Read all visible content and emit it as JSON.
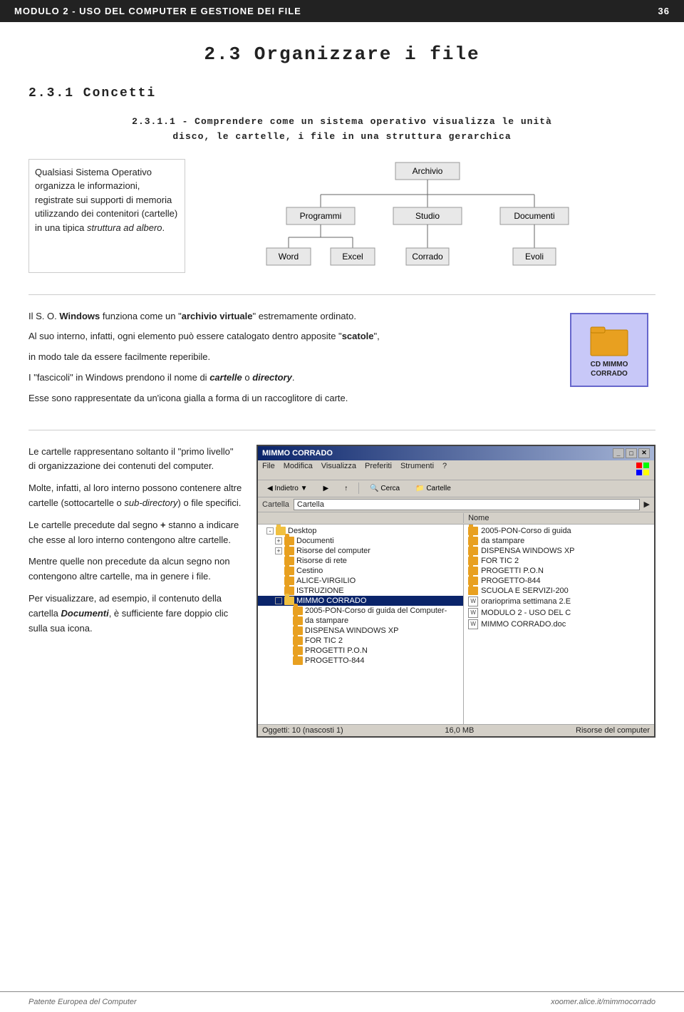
{
  "header": {
    "left": "MODULO 2  -  USO DEL COMPUTER E GESTIONE DEI  FILE",
    "right": "36"
  },
  "section": {
    "title": "2.3  Organizzare i file",
    "sub1": "2.3.1  Concetti",
    "sub2_title": "2.3.1.1  -  Comprendere  come  un  sistema  operativo  visualizza  le  unità",
    "sub2_line2": "disco,  le  cartelle,  i  file  in  una  struttura  gerarchica"
  },
  "intro_text": "Qualsiasi Sistema Operativo organizza le informazioni, registrate sui supporti di memoria utilizzando dei contenitori (cartelle) in una tipica struttura ad albero.",
  "tree": {
    "root": "Archivio",
    "level1": [
      "Programmi",
      "Studio",
      "Documenti"
    ],
    "level2": [
      "Word",
      "Excel",
      "Corrado",
      "Evoli"
    ]
  },
  "middle_paragraphs": [
    {
      "text": "Il S. O. ",
      "bold": "Windows",
      "rest": " funziona come un \"archivio virtuale\" estremamente ordinato."
    },
    {
      "plain": "Al suo interno, infatti, ogni elemento può essere catalogato dentro apposite \"scatole\","
    },
    {
      "plain": "in modo tale da essere facilmente reperibile."
    },
    {
      "plain": "I \"fascicoli\" in Windows prendono il nome di cartelle o directory."
    },
    {
      "plain": "Esse sono rappresentate da un'icona gialla a forma di un raccoglitore di carte."
    }
  ],
  "folder_label": "CD   MIMMO\nCORRADO",
  "bottom_left_paragraphs": [
    "Le  cartelle  rappresentano  soltanto  il \"primo  livello\"  di  organizzazione  dei contenuti del computer.",
    "Molte,  infatti,  al  loro  interno  possono contenere  altre  cartelle  (sottocartelle  o sub-directory) o file specifici.",
    "Le cartelle precedute dal segno + stanno a  indicare  che  esse  al  loro  interno contengono altre cartelle.",
    "Mentre  quelle  non  precedute  da  alcun segno  non  contengono  altre  cartelle,  ma in genere i file.",
    "Per visualizzare, ad esempio, il contenuto della  cartella  Documenti,  è  sufficiente fare doppio clic sulla sua icona."
  ],
  "explorer": {
    "title": "MIMMO CORRADO",
    "menu": [
      "File",
      "Modifica",
      "Visualizza",
      "Preferiti",
      "Strumenti",
      "?"
    ],
    "toolbar_buttons": [
      "Indietro",
      "Avanti",
      "Su",
      "Cerca",
      "Cartelle"
    ],
    "address_label": "Cartella",
    "address_value": "Cartella",
    "columns": [
      "Nome"
    ],
    "left_items": [
      {
        "label": "Desktop",
        "indent": 1,
        "expanded": true,
        "selected": false
      },
      {
        "label": "Documenti",
        "indent": 2,
        "expanded": false,
        "selected": false
      },
      {
        "label": "Risorse del computer",
        "indent": 2,
        "expanded": false,
        "selected": false
      },
      {
        "label": "Risorse di rete",
        "indent": 2,
        "expanded": false,
        "selected": false
      },
      {
        "label": "Cestino",
        "indent": 2,
        "expanded": false,
        "selected": false
      },
      {
        "label": "ALICE-VIRGILIO",
        "indent": 2,
        "expanded": false,
        "selected": false
      },
      {
        "label": "ISTRUZIONE",
        "indent": 2,
        "expanded": false,
        "selected": false
      },
      {
        "label": "MIMMO CORRADO",
        "indent": 2,
        "expanded": true,
        "selected": true
      },
      {
        "label": "2005-PON-Corso di guida del Computer-",
        "indent": 3,
        "expanded": false,
        "selected": false
      },
      {
        "label": "da stampare",
        "indent": 3,
        "expanded": false,
        "selected": false
      },
      {
        "label": "DISPENSA WINDOWS XP",
        "indent": 3,
        "expanded": false,
        "selected": false
      },
      {
        "label": "FOR TIC 2",
        "indent": 3,
        "expanded": false,
        "selected": false
      },
      {
        "label": "PROGETTI P.O.N",
        "indent": 3,
        "expanded": false,
        "selected": false
      },
      {
        "label": "PROGETTO-844",
        "indent": 3,
        "expanded": false,
        "selected": false
      }
    ],
    "right_items": [
      {
        "label": "2005-PON-Corso di guida",
        "type": "folder"
      },
      {
        "label": "da stampare",
        "type": "folder"
      },
      {
        "label": "DISPENSA WINDOWS XP",
        "type": "folder"
      },
      {
        "label": "FOR TIC 2",
        "type": "folder"
      },
      {
        "label": "PROGETTI P.O.N",
        "type": "folder"
      },
      {
        "label": "PROGETTO-844",
        "type": "folder"
      },
      {
        "label": "SCUOLA E SERVIZI-200",
        "type": "folder"
      },
      {
        "label": "orarioprima settimana 2.E",
        "type": "doc"
      },
      {
        "label": "MODULO 2 - USO DEL C",
        "type": "doc"
      },
      {
        "label": "MIMMO CORRADO.doc",
        "type": "doc"
      }
    ],
    "statusbar_left": "Oggetti: 10 (nascosti 1)",
    "statusbar_right": "16,0 MB",
    "statusbar_location": "Risorse del computer"
  },
  "footer": {
    "left": "Patente Europea del Computer",
    "right": "xoomer.alice.it/mimmocorrado"
  }
}
